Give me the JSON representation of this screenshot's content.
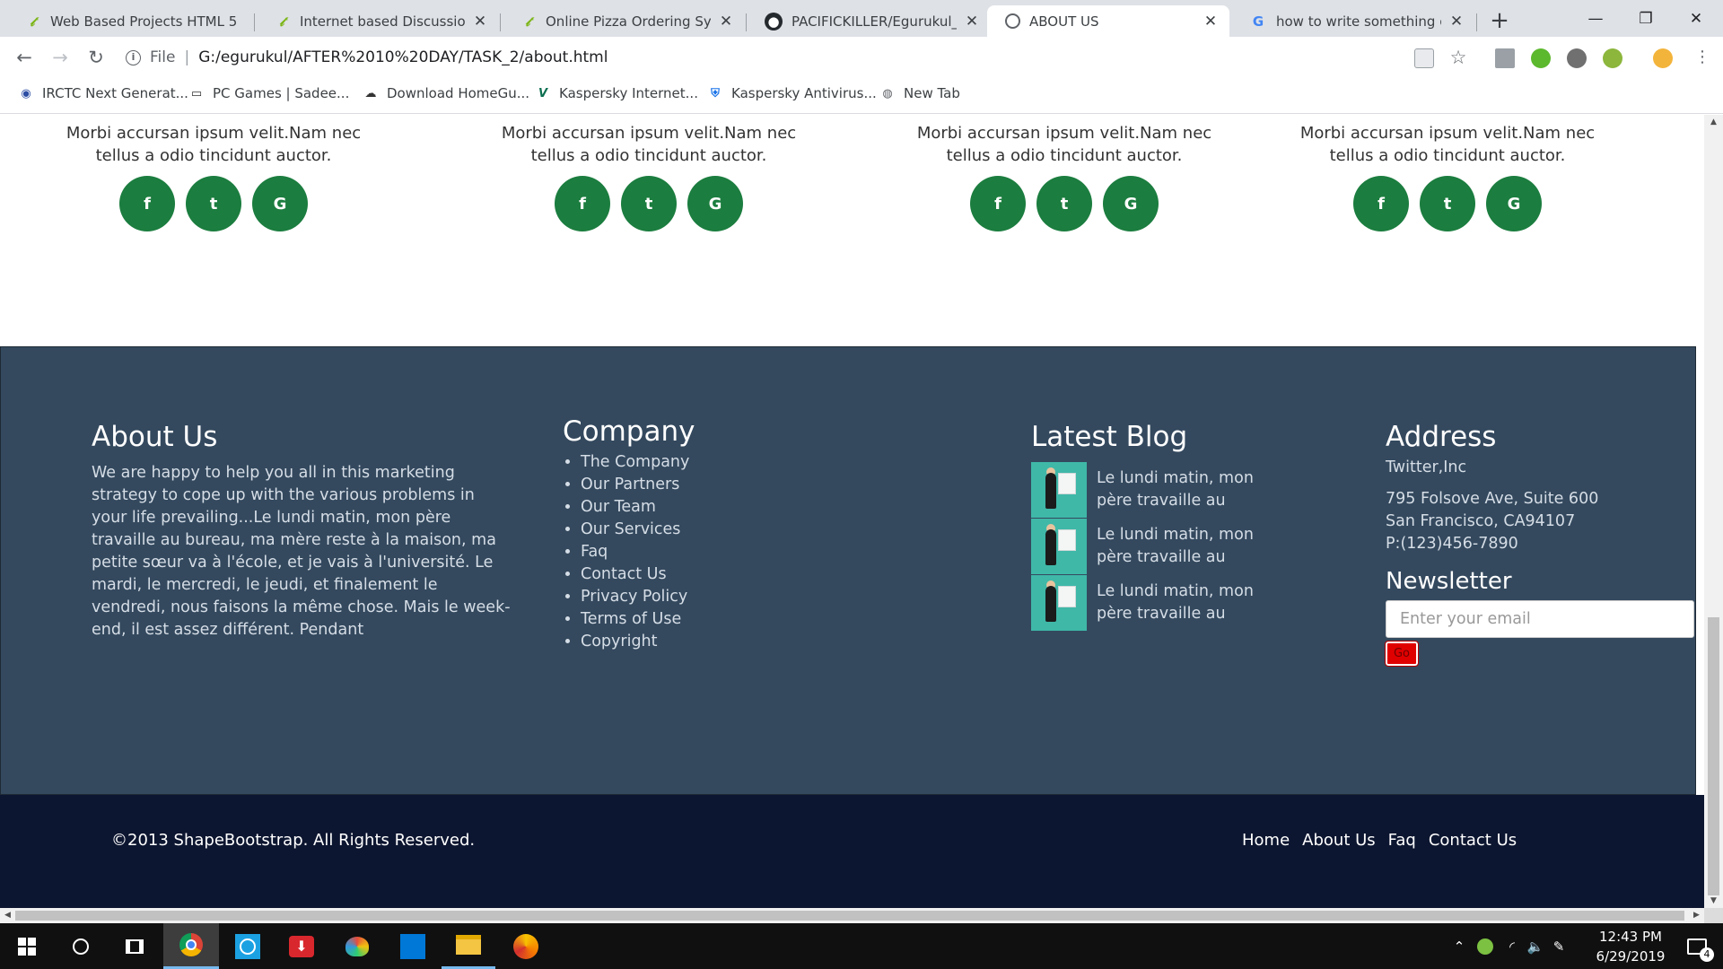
{
  "browser": {
    "tabs": [
      {
        "title": "Web Based Projects HTML 5",
        "icon": "leaf-icon"
      },
      {
        "title": "Internet based Discussion Fo",
        "icon": "leaf-icon"
      },
      {
        "title": "Online Pizza Ordering Systen",
        "icon": "leaf-icon"
      },
      {
        "title": "PACIFICKILLER/Egurukul_TAS",
        "icon": "github-icon"
      },
      {
        "title": "ABOUT US",
        "icon": "globe-icon"
      },
      {
        "title": "how to write something on c",
        "icon": "google-icon"
      }
    ],
    "active_tab_index": 4,
    "address": {
      "scheme": "File",
      "url": "G:/egurukul/AFTER%2010%20DAY/TASK_2/about.html"
    },
    "bookmarks": [
      "IRCTC Next Generat...",
      "PC Games | Sadee...",
      "Download HomeGu...",
      "Kaspersky Internet...",
      "Kaspersky Antivirus...",
      "New Tab"
    ]
  },
  "team": {
    "members": [
      {
        "desc_line1": "Morbi accursan ipsum velit.Nam nec",
        "desc_line2": "tellus a odio tincidunt auctor."
      },
      {
        "desc_line1": "Morbi accursan ipsum velit.Nam nec",
        "desc_line2": "tellus a odio tincidunt auctor."
      },
      {
        "desc_line1": "Morbi accursan ipsum velit.Nam nec",
        "desc_line2": "tellus a odio tincidunt auctor."
      },
      {
        "desc_line1": "Morbi accursan ipsum velit.Nam nec",
        "desc_line2": "tellus a odio tincidunt auctor."
      }
    ],
    "social_labels": {
      "facebook": "f",
      "twitter": "t",
      "google": "G"
    },
    "accent_color": "#1b7d3f"
  },
  "footer": {
    "about": {
      "heading": "About Us",
      "text": "We are happy to help you all in this marketing strategy to cope up with the various problems in your life prevailing...Le lundi matin, mon père travaille au bureau, ma mère reste à la maison, ma petite sœur va à l'école, et je vais à l'université. Le mardi, le mercredi, le jeudi, et finalement le vendredi, nous faisons la même chose. Mais le week-end, il est assez différent. Pendant"
    },
    "company": {
      "heading": "Company",
      "links": [
        "The Company",
        "Our Partners",
        "Our Team",
        "Our Services",
        "Faq",
        "Contact Us",
        "Privacy Policy",
        "Terms of Use",
        "Copyright"
      ]
    },
    "blog": {
      "heading": "Latest Blog",
      "posts": [
        {
          "line1": "Le lundi matin, mon",
          "line2": "père travaille au"
        },
        {
          "line1": "Le lundi matin, mon",
          "line2": "père travaille au"
        },
        {
          "line1": "Le lundi matin, mon",
          "line2": "père travaille au"
        }
      ]
    },
    "address": {
      "heading": "Address",
      "company": "Twitter,Inc",
      "street": "795 Folsove Ave, Suite 600",
      "city": "San Francisco, CA94107",
      "phone": "P:(123)456-7890"
    },
    "newsletter": {
      "heading": "Newsletter",
      "placeholder": "Enter your email",
      "button": "Go"
    },
    "bottom": {
      "copyright": "©2013 ShapeBootstrap. All Rights Reserved.",
      "links": [
        "Home",
        "About Us",
        "Faq",
        "Contact Us"
      ]
    },
    "colors": {
      "main_bg": "#34495e",
      "bottom_bg": "#0d1630",
      "go_button": "#e00000"
    }
  },
  "taskbar": {
    "time": "12:43 PM",
    "date": "6/29/2019",
    "notification_count": "4"
  }
}
